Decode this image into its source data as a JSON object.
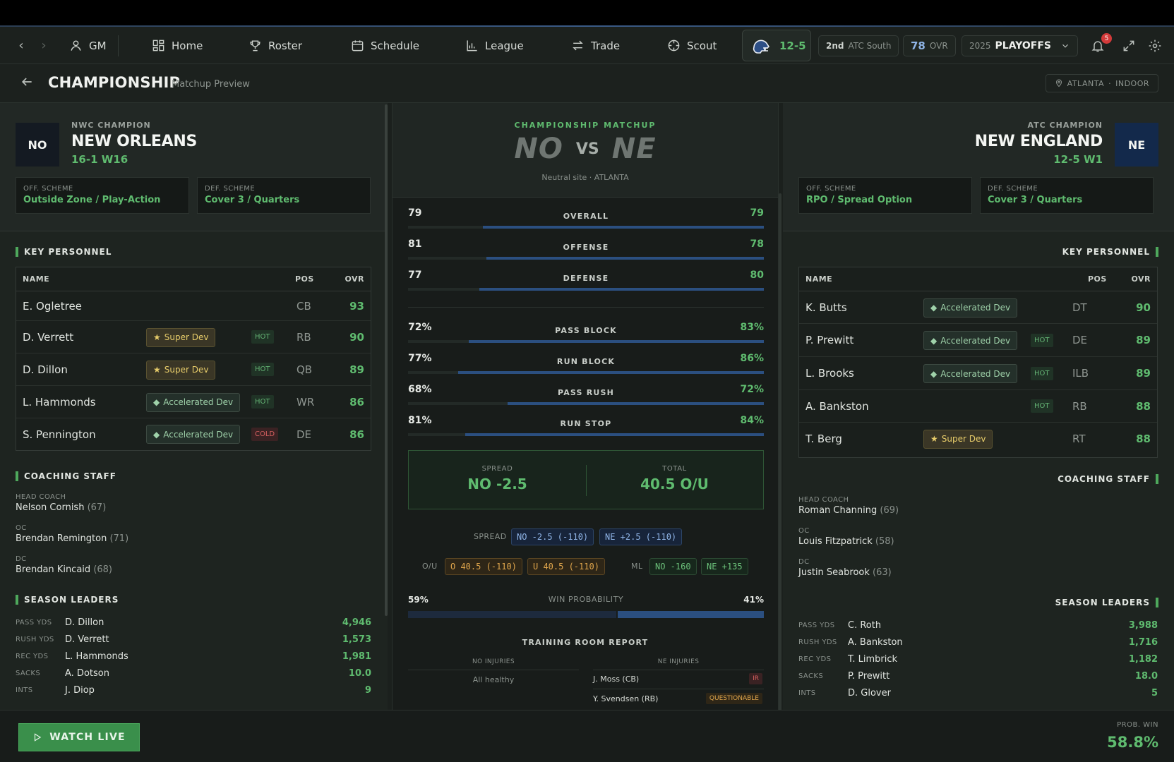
{
  "nav": {
    "back_glyph": "‹",
    "forward_glyph": "›",
    "items": [
      {
        "label": "GM",
        "icon": "user-icon"
      },
      {
        "label": "Home",
        "icon": "home-grid-icon"
      },
      {
        "label": "Roster",
        "icon": "trophy-icon"
      },
      {
        "label": "Schedule",
        "icon": "calendar-icon"
      },
      {
        "label": "League",
        "icon": "bar-chart-icon"
      },
      {
        "label": "Trade",
        "icon": "swap-icon"
      },
      {
        "label": "Scout",
        "icon": "crosshair-icon"
      }
    ],
    "record": "12-5",
    "standing_rank": "2nd",
    "standing_division": "ATC South",
    "ovr_value": "78",
    "ovr_label": "OVR",
    "season_year": "2025",
    "season_phase": "PLAYOFFS",
    "notifications_count": "5"
  },
  "header": {
    "title": "CHAMPIONSHIP",
    "subtitle": "Matchup Preview",
    "venue_city": "ATLANTA",
    "venue_type": "INDOOR"
  },
  "home": {
    "abbr": "NO",
    "abbr_bg": "#141a22",
    "kicker": "NWC CHAMPION",
    "name": "NEW ORLEANS",
    "record": "16-1 W16",
    "off_scheme_label": "OFF. SCHEME",
    "off_scheme": "Outside Zone / Play-Action",
    "def_scheme_label": "DEF. SCHEME",
    "def_scheme": "Cover 3 / Quarters",
    "personnel_title": "KEY PERSONNEL",
    "cols": {
      "name": "NAME",
      "pos": "POS",
      "ovr": "OVR"
    },
    "players": [
      {
        "name": "E. Ogletree",
        "dev": "",
        "form": "",
        "pos": "CB",
        "ovr": "93"
      },
      {
        "name": "D. Verrett",
        "dev": "Super Dev",
        "form": "HOT",
        "pos": "RB",
        "ovr": "90"
      },
      {
        "name": "D. Dillon",
        "dev": "Super Dev",
        "form": "HOT",
        "pos": "QB",
        "ovr": "89"
      },
      {
        "name": "L. Hammonds",
        "dev": "Accelerated Dev",
        "form": "HOT",
        "pos": "WR",
        "ovr": "86"
      },
      {
        "name": "S. Pennington",
        "dev": "Accelerated Dev",
        "form": "COLD",
        "pos": "DE",
        "ovr": "86"
      }
    ],
    "staff_title": "COACHING STAFF",
    "staff": [
      {
        "role": "HEAD COACH",
        "name": "Nelson Cornish",
        "rating": "(67)"
      },
      {
        "role": "OC",
        "name": "Brendan Remington",
        "rating": "(71)"
      },
      {
        "role": "DC",
        "name": "Brendan Kincaid",
        "rating": "(68)"
      }
    ],
    "leaders_title": "SEASON LEADERS",
    "leaders": [
      {
        "stat": "PASS YDS",
        "player": "D. Dillon",
        "value": "4,946"
      },
      {
        "stat": "RUSH YDS",
        "player": "D. Verrett",
        "value": "1,573"
      },
      {
        "stat": "REC YDS",
        "player": "L. Hammonds",
        "value": "1,981"
      },
      {
        "stat": "SACKS",
        "player": "A. Dotson",
        "value": "10.0"
      },
      {
        "stat": "INTS",
        "player": "J. Diop",
        "value": "9"
      }
    ]
  },
  "away": {
    "abbr": "NE",
    "abbr_bg": "#13294b",
    "kicker": "ATC CHAMPION",
    "name": "NEW ENGLAND",
    "record": "12-5 W1",
    "off_scheme_label": "OFF. SCHEME",
    "off_scheme": "RPO / Spread Option",
    "def_scheme_label": "DEF. SCHEME",
    "def_scheme": "Cover 3 / Quarters",
    "personnel_title": "KEY PERSONNEL",
    "cols": {
      "name": "NAME",
      "pos": "POS",
      "ovr": "OVR"
    },
    "players": [
      {
        "name": "K. Butts",
        "dev": "Accelerated Dev",
        "form": "",
        "pos": "DT",
        "ovr": "90"
      },
      {
        "name": "P. Prewitt",
        "dev": "Accelerated Dev",
        "form": "HOT",
        "pos": "DE",
        "ovr": "89"
      },
      {
        "name": "L. Brooks",
        "dev": "Accelerated Dev",
        "form": "HOT",
        "pos": "ILB",
        "ovr": "89"
      },
      {
        "name": "A. Bankston",
        "dev": "",
        "form": "HOT",
        "pos": "RB",
        "ovr": "88"
      },
      {
        "name": "T. Berg",
        "dev": "Super Dev",
        "form": "",
        "pos": "RT",
        "ovr": "88"
      }
    ],
    "staff_title": "COACHING STAFF",
    "staff": [
      {
        "role": "HEAD COACH",
        "name": "Roman Channing",
        "rating": "(69)"
      },
      {
        "role": "OC",
        "name": "Louis Fitzpatrick",
        "rating": "(58)"
      },
      {
        "role": "DC",
        "name": "Justin Seabrook",
        "rating": "(63)"
      }
    ],
    "leaders_title": "SEASON LEADERS",
    "leaders": [
      {
        "stat": "PASS YDS",
        "player": "C. Roth",
        "value": "3,988"
      },
      {
        "stat": "RUSH YDS",
        "player": "A. Bankston",
        "value": "1,716"
      },
      {
        "stat": "REC YDS",
        "player": "T. Limbrick",
        "value": "1,182"
      },
      {
        "stat": "SACKS",
        "player": "P. Prewitt",
        "value": "18.0"
      },
      {
        "stat": "INTS",
        "player": "D. Glover",
        "value": "5"
      }
    ]
  },
  "matchup": {
    "kicker": "CHAMPIONSHIP MATCHUP",
    "home_abbr": "NO",
    "vs": "VS",
    "away_abbr": "NE",
    "site": "Neutral site · ATLANTA",
    "ratings": [
      {
        "label": "OVERALL",
        "home": "79",
        "away": "79",
        "away_fill": 0.79
      },
      {
        "label": "OFFENSE",
        "home": "81",
        "away": "78",
        "away_fill": 0.78
      },
      {
        "label": "DEFENSE",
        "home": "77",
        "away": "80",
        "away_fill": 0.8
      }
    ],
    "line_stats": [
      {
        "label": "PASS BLOCK",
        "home": "72%",
        "away": "83%",
        "away_fill": 0.83
      },
      {
        "label": "RUN BLOCK",
        "home": "77%",
        "away": "86%",
        "away_fill": 0.86
      },
      {
        "label": "PASS RUSH",
        "home": "68%",
        "away": "72%",
        "away_fill": 0.72
      },
      {
        "label": "RUN STOP",
        "home": "81%",
        "away": "84%",
        "away_fill": 0.84
      }
    ],
    "spread_label": "SPREAD",
    "spread_value": "NO -2.5",
    "total_label": "TOTAL",
    "total_value": "40.5 O/U",
    "odds": {
      "spread_label": "SPREAD",
      "spread_home": "NO -2.5 (-110)",
      "spread_away": "NE +2.5 (-110)",
      "ou_label": "O/U",
      "over": "O 40.5 (-110)",
      "under": "U 40.5 (-110)",
      "ml_label": "ML",
      "ml_home": "NO -160",
      "ml_away": "NE +135"
    },
    "win_prob_label": "WIN PROBABILITY",
    "win_prob_home": "59%",
    "win_prob_away": "41%",
    "win_prob_home_fraction": 0.59,
    "injury_title": "TRAINING ROOM REPORT",
    "home_injuries_label": "NO INJURIES",
    "home_injuries_note": "All healthy",
    "away_injuries_label": "NE INJURIES",
    "away_injuries": [
      {
        "player": "J. Moss (CB)",
        "status": "IR"
      },
      {
        "player": "Y. Svendsen (RB)",
        "status": "QUESTIONABLE"
      }
    ]
  },
  "footer": {
    "watch_label": "WATCH LIVE",
    "prob_label": "PROB. WIN",
    "prob_value": "58.8%"
  },
  "colors": {
    "accent_green": "#5fbb6f",
    "away_bar": "#2b4f80",
    "home_bar": "#1d2a3d"
  }
}
